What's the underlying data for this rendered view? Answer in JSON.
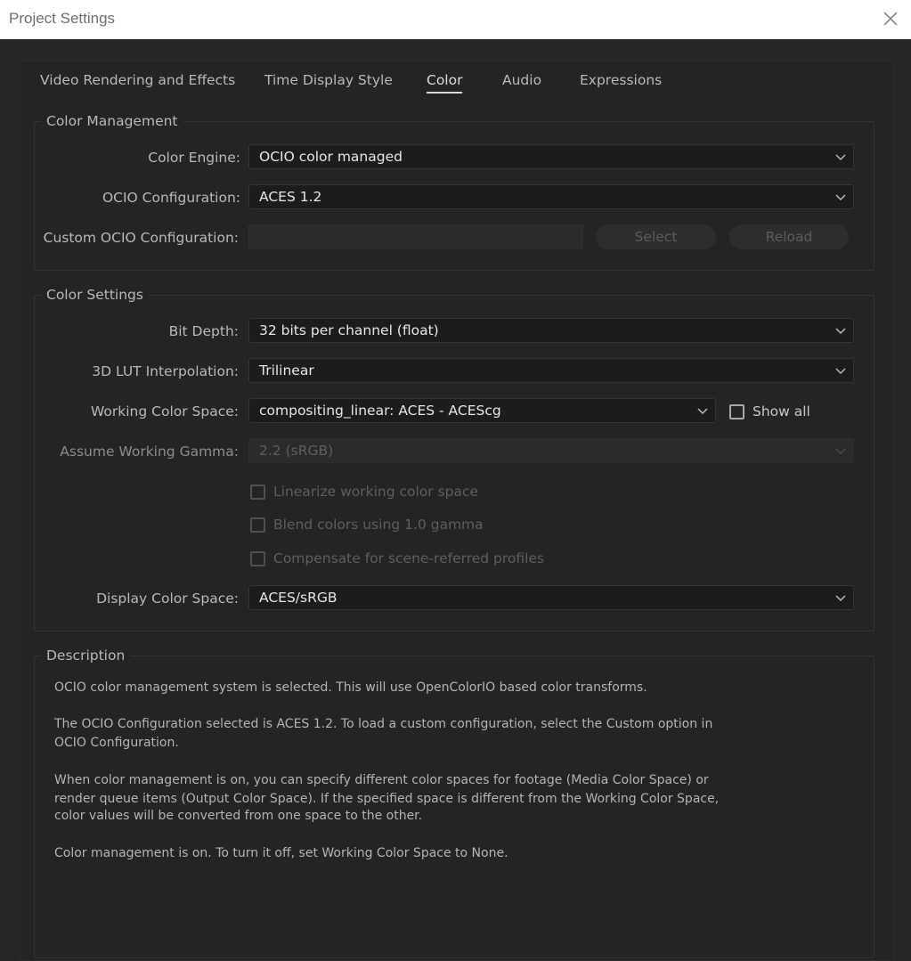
{
  "window": {
    "title": "Project Settings"
  },
  "tabs": [
    {
      "label": "Video Rendering and Effects",
      "active": false
    },
    {
      "label": "Time Display Style",
      "active": false
    },
    {
      "label": "Color",
      "active": true
    },
    {
      "label": "Audio",
      "active": false
    },
    {
      "label": "Expressions",
      "active": false
    }
  ],
  "color_management": {
    "title": "Color Management",
    "color_engine": {
      "label": "Color Engine:",
      "value": "OCIO color managed"
    },
    "ocio_config": {
      "label": "OCIO Configuration:",
      "value": "ACES 1.2"
    },
    "custom_ocio": {
      "label": "Custom OCIO Configuration:",
      "value": "",
      "select_label": "Select",
      "reload_label": "Reload"
    }
  },
  "color_settings": {
    "title": "Color Settings",
    "bit_depth": {
      "label": "Bit Depth:",
      "value": "32 bits per channel (float)"
    },
    "lut_interp": {
      "label": "3D LUT Interpolation:",
      "value": "Trilinear"
    },
    "working_space": {
      "label": "Working Color Space:",
      "value": "compositing_linear: ACES - ACEScg"
    },
    "show_all": {
      "label": "Show all",
      "checked": false
    },
    "gamma": {
      "label": "Assume Working Gamma:",
      "value": "2.2 (sRGB)"
    },
    "linearize": {
      "label": "Linearize working color space",
      "checked": false
    },
    "blend": {
      "label": "Blend colors using 1.0 gamma",
      "checked": false
    },
    "compensate": {
      "label": "Compensate for scene-referred profiles",
      "checked": false
    },
    "display_space": {
      "label": "Display Color Space:",
      "value": "ACES/sRGB"
    }
  },
  "description": {
    "title": "Description",
    "p1": "OCIO color management system is selected. This will use OpenColorIO based color transforms.",
    "p2_l1": "The OCIO Configuration selected is ACES 1.2. To load a custom configuration, select the Custom option in",
    "p2_l2": "OCIO Configuration.",
    "p3_l1": "When color management is on, you can specify different color spaces for footage (Media Color Space) or",
    "p3_l2": "render queue items (Output Color Space). If the specified space is different from the Working Color Space,",
    "p3_l3": "color values will be converted from one space to the other.",
    "p4": "Color management is on. To turn it off, set Working Color Space to None."
  }
}
